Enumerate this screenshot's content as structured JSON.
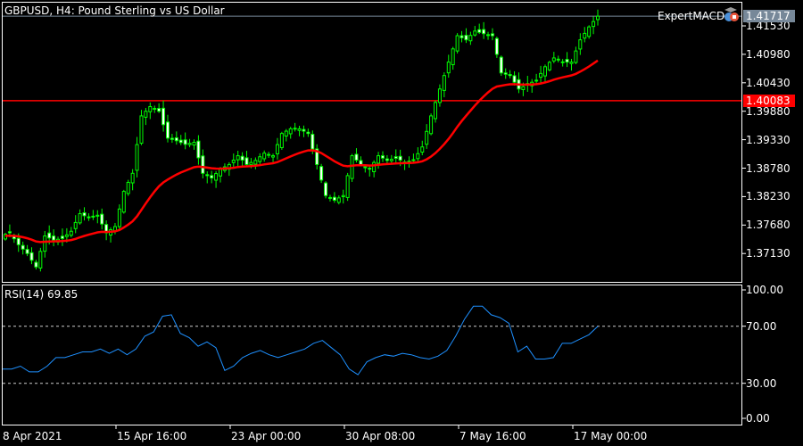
{
  "header": {
    "title": "GBPUSD, H4:  Pound Sterling vs US Dollar",
    "expert_label": "ExpertMACD"
  },
  "price_axis": {
    "ticks": [
      "1.41530",
      "1.40980",
      "1.40430",
      "1.39880",
      "1.39330",
      "1.38780",
      "1.38230",
      "1.37680",
      "1.37130"
    ],
    "tick_values": [
      1.4153,
      1.4098,
      1.4043,
      1.3988,
      1.3933,
      1.3878,
      1.3823,
      1.3768,
      1.3713
    ],
    "current_price": "1.41717",
    "current_price_value": 1.41717,
    "level_price": "1.40083",
    "level_price_value": 1.40083
  },
  "rsi": {
    "label": "RSI(14) 69.85",
    "ticks": [
      "100.00",
      "70.00",
      "30.00",
      "0.00"
    ],
    "tick_values": [
      100,
      70,
      30,
      0
    ],
    "levels": [
      70,
      30
    ]
  },
  "time_axis": {
    "labels": [
      "8 Apr 2021",
      "15 Apr 16:00",
      "23 Apr 00:00",
      "30 Apr 08:00",
      "7 May 16:00",
      "17 May 00:00"
    ]
  },
  "colors": {
    "bull": "#00ff00",
    "line_ma": "#ff0000",
    "rsi_line": "#1e90ff",
    "level": "#ff0000",
    "current": "#778899"
  },
  "chart_data": [
    {
      "type": "candlestick",
      "title": "GBPUSD, H4",
      "ylim": [
        1.368,
        1.4195
      ],
      "closes": [
        1.3747,
        1.3753,
        1.373,
        1.3713,
        1.3687,
        1.3747,
        1.3739,
        1.3742,
        1.3756,
        1.379,
        1.3782,
        1.3787,
        1.3753,
        1.3765,
        1.3833,
        1.3868,
        1.3979,
        1.3997,
        1.3988,
        1.3936,
        1.3931,
        1.3924,
        1.3928,
        1.3868,
        1.3859,
        1.3876,
        1.3885,
        1.3902,
        1.3885,
        1.3893,
        1.3907,
        1.3902,
        1.3945,
        1.3954,
        1.3954,
        1.3945,
        1.3885,
        1.3825,
        1.3816,
        1.3825,
        1.3902,
        1.3885,
        1.3876,
        1.3902,
        1.3893,
        1.3897,
        1.389,
        1.3893,
        1.3919,
        1.3979,
        1.4031,
        1.4083,
        1.4134,
        1.4126,
        1.4143,
        1.4138,
        1.4134,
        1.4062,
        1.4057,
        1.4031,
        1.404,
        1.4048,
        1.4074,
        1.4091,
        1.4083,
        1.4083,
        1.4126,
        1.4151,
        1.41717
      ]
    },
    {
      "type": "line",
      "title": "RSI(14)",
      "ylim": [
        0,
        100
      ],
      "values": [
        40,
        40,
        42,
        38,
        38,
        42,
        48,
        48,
        50,
        52,
        52,
        54,
        51,
        54,
        50,
        54,
        63,
        66,
        77,
        78,
        65,
        62,
        56,
        59,
        55,
        39,
        42,
        48,
        51,
        53,
        50,
        48,
        50,
        52,
        54,
        58,
        60,
        55,
        50,
        40,
        36,
        45,
        48,
        50,
        49,
        51,
        50,
        48,
        47,
        49,
        53,
        63,
        75,
        84,
        84,
        78,
        76,
        72,
        52,
        56,
        47,
        47,
        48,
        58,
        58,
        61,
        64,
        69.85
      ]
    }
  ]
}
